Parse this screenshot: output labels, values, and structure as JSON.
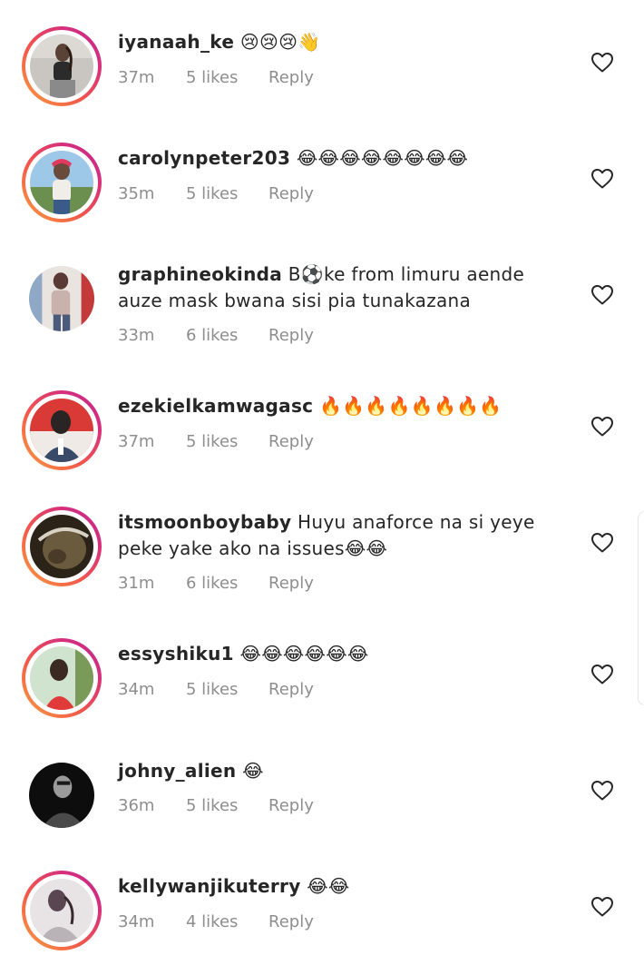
{
  "comments": [
    {
      "username": "iyanaah_ke",
      "text": "😢😢😢👋",
      "time": "37m",
      "likes": "5 likes",
      "reply": "Reply",
      "avatar_style": "story",
      "avatar_colors": [
        "#c9c6c2",
        "#5a4236",
        "#2b2b2b"
      ]
    },
    {
      "username": "carolynpeter203",
      "text": "😂😂😂😂😂😂😂😂",
      "time": "35m",
      "likes": "5 likes",
      "reply": "Reply",
      "avatar_style": "story",
      "avatar_colors": [
        "#9ec8e8",
        "#e23a5e",
        "#f1eee9"
      ]
    },
    {
      "username": "graphineokinda",
      "text": "B⚽ke from limuru aende auze mask bwana sisi pia tunakazana",
      "time": "33m",
      "likes": "6 likes",
      "reply": "Reply",
      "avatar_style": "plain",
      "avatar_colors": [
        "#e9e4df",
        "#5a3a35",
        "#8fa8c6"
      ]
    },
    {
      "username": "ezekielkamwagasc",
      "text": "🔥🔥🔥🔥🔥🔥🔥🔥",
      "time": "37m",
      "likes": "5 likes",
      "reply": "Reply",
      "avatar_style": "story",
      "avatar_colors": [
        "#d93a36",
        "#2a2524",
        "#3a4b6a"
      ]
    },
    {
      "username": "itsmoonboybaby",
      "text": "Huyu anaforce na si yeye peke yake ako na issues😂😂",
      "time": "31m",
      "likes": "6 likes",
      "reply": "Reply",
      "avatar_style": "story",
      "avatar_colors": [
        "#6a5a3e",
        "#2b2218",
        "#d8d2c4"
      ]
    },
    {
      "username": "essyshiku1",
      "text": "😂😂😂😂😂😂",
      "time": "34m",
      "likes": "5 likes",
      "reply": "Reply",
      "avatar_style": "story",
      "avatar_colors": [
        "#cfe3cf",
        "#3a2a22",
        "#e03a3a"
      ]
    },
    {
      "username": "johny_alien",
      "text": "😂",
      "time": "36m",
      "likes": "5 likes",
      "reply": "Reply",
      "avatar_style": "plain",
      "avatar_colors": [
        "#0d0d0d",
        "#9a9a9a",
        "#4a4a4a"
      ]
    },
    {
      "username": "kellywanjikuterry",
      "text": "😂😂",
      "time": "34m",
      "likes": "4 likes",
      "reply": "Reply",
      "avatar_style": "story",
      "avatar_colors": [
        "#e8e4e6",
        "#5a4650",
        "#b9b2b6"
      ]
    }
  ],
  "icons": {
    "like": "heart-outline-icon"
  },
  "colors": {
    "story_ring_start": "#f9a13f",
    "story_ring_end": "#c3298f",
    "meta_text": "#8e8e8e",
    "primary_text": "#262626"
  }
}
